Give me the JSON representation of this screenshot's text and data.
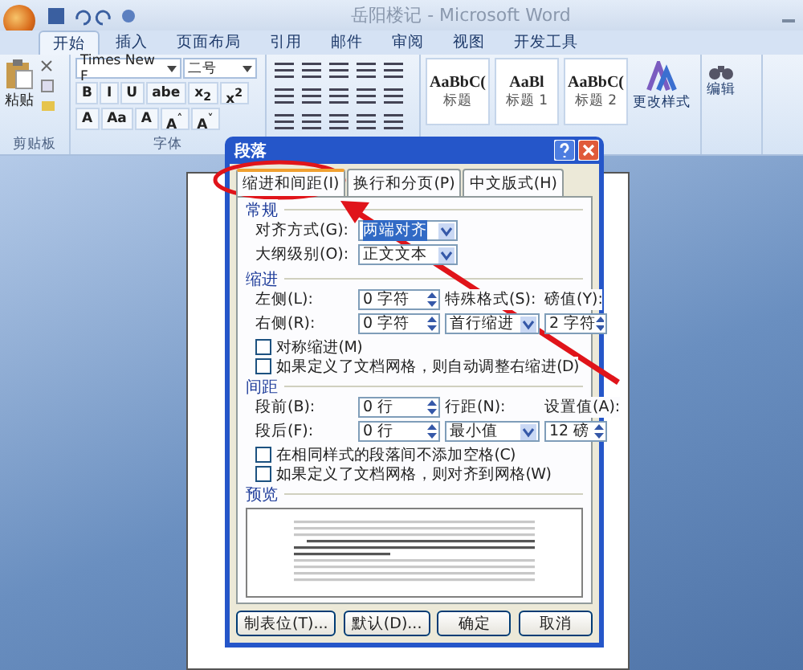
{
  "window": {
    "title": "岳阳楼记 - Microsoft Word"
  },
  "ribbon_tabs": [
    {
      "label": "开始",
      "selected": true
    },
    {
      "label": "插入",
      "selected": false
    },
    {
      "label": "页面布局",
      "selected": false
    },
    {
      "label": "引用",
      "selected": false
    },
    {
      "label": "邮件",
      "selected": false
    },
    {
      "label": "审阅",
      "selected": false
    },
    {
      "label": "视图",
      "selected": false
    },
    {
      "label": "开发工具",
      "selected": false
    }
  ],
  "clipboard": {
    "paste": "粘贴",
    "group_label": "剪贴板"
  },
  "font": {
    "name": "Times New F",
    "size": "二号",
    "group_label": "字体",
    "format_buttons": [
      "B",
      "I",
      "U",
      "abe",
      "x$_{2}$",
      "x$^{2}$"
    ],
    "effect_buttons": [
      "A",
      "Aa",
      "A",
      "A$^{˄}$",
      "A$^{˅}$"
    ]
  },
  "styles": {
    "items": [
      {
        "preview": "AaBbC(",
        "label": "标题"
      },
      {
        "preview": "AaBl",
        "label": "标题 1"
      },
      {
        "preview": "AaBbC(",
        "label": "标题 2"
      }
    ],
    "change": "更改样式"
  },
  "editing": {
    "label": "编辑"
  },
  "dialog": {
    "title": "段落",
    "tabs": [
      {
        "label": "缩进和间距(I)",
        "selected": true
      },
      {
        "label": "换行和分页(P)",
        "selected": false
      },
      {
        "label": "中文版式(H)",
        "selected": false
      }
    ],
    "sections": [
      {
        "title": "常规",
        "rows": [
          [
            {
              "kind": "label",
              "text": "对齐方式(G):"
            },
            {
              "kind": "select",
              "text": "两端对齐",
              "focused": true
            }
          ],
          [
            {
              "kind": "label",
              "text": "大纲级别(O):"
            },
            {
              "kind": "select",
              "text": "正文文本",
              "focused": false
            }
          ]
        ]
      },
      {
        "title": "缩进",
        "rows": [
          [
            {
              "kind": "label",
              "text": "左侧(L):"
            },
            {
              "kind": "spin",
              "text": "0 字符"
            },
            {
              "kind": "label",
              "text": "特殊格式(S):"
            },
            {
              "kind": "label",
              "text": "磅值(Y):"
            }
          ],
          [
            {
              "kind": "label",
              "text": "右侧(R):"
            },
            {
              "kind": "spin",
              "text": "0 字符"
            },
            {
              "kind": "select",
              "text": "首行缩进",
              "focused": false
            },
            {
              "kind": "spin",
              "text": "2 字符"
            }
          ]
        ],
        "checks": [
          {
            "label": "对称缩进(M)",
            "checked": false
          },
          {
            "label": "如果定义了文档网格，则自动调整右缩进(D)",
            "checked": false
          }
        ]
      },
      {
        "title": "间距",
        "rows": [
          [
            {
              "kind": "label",
              "text": "段前(B):"
            },
            {
              "kind": "spin",
              "text": "0 行"
            },
            {
              "kind": "label",
              "text": "行距(N):"
            },
            {
              "kind": "label",
              "text": "设置值(A):"
            }
          ],
          [
            {
              "kind": "label",
              "text": "段后(F):"
            },
            {
              "kind": "spin",
              "text": "0 行"
            },
            {
              "kind": "select",
              "text": "最小值",
              "focused": false
            },
            {
              "kind": "spin",
              "text": "12 磅"
            }
          ]
        ],
        "checks": [
          {
            "label": "在相同样式的段落间不添加空格(C)",
            "checked": false
          },
          {
            "label": "如果定义了文档网格，则对齐到网格(W)",
            "checked": false
          }
        ]
      }
    ],
    "preview_title": "预览",
    "buttons": [
      "制表位(T)...",
      "默认(D)...",
      "确定",
      "取消"
    ]
  }
}
